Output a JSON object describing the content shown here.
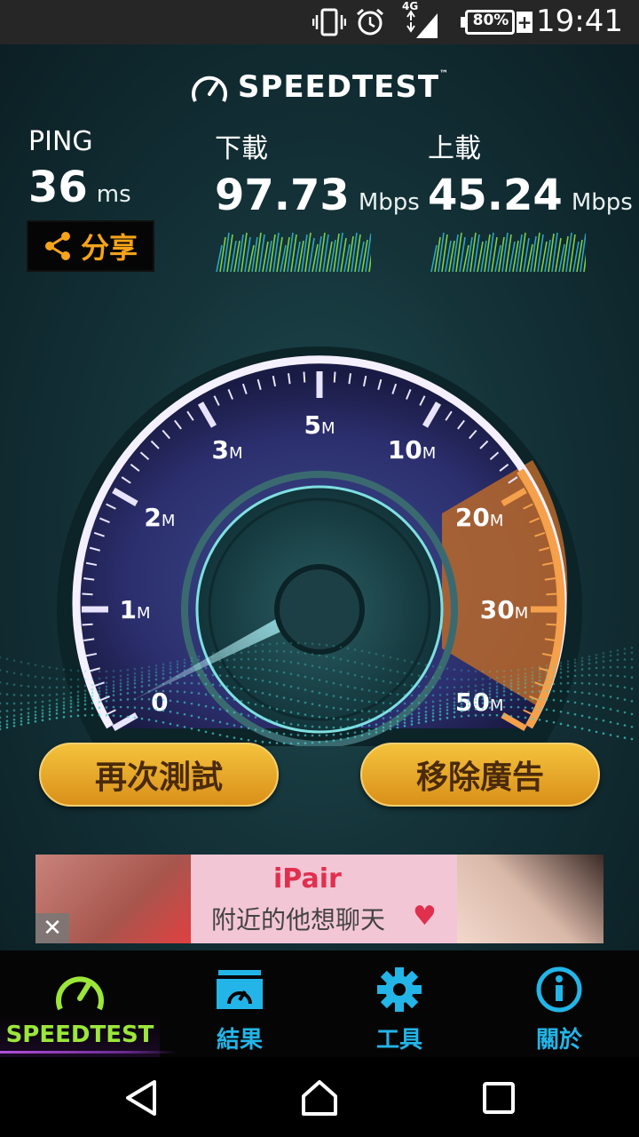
{
  "status_bar": {
    "time": "19:41",
    "battery": "80%",
    "network": "4G",
    "icons": [
      "vibrate-icon",
      "alarm-icon",
      "signal-icon",
      "battery-icon"
    ]
  },
  "app": {
    "brand": "SPEEDTEST",
    "brand_tm": "™"
  },
  "metrics": {
    "ping": {
      "label": "PING",
      "value": "36",
      "unit": "ms"
    },
    "download": {
      "label": "下載",
      "value": "97.73",
      "unit": "Mbps"
    },
    "upload": {
      "label": "上載",
      "value": "45.24",
      "unit": "Mbps"
    }
  },
  "share": {
    "label": "分享"
  },
  "gauge": {
    "scale_labels": [
      "0",
      "1",
      "2",
      "3",
      "5",
      "10",
      "20",
      "30",
      "50"
    ],
    "unit_letter": "M"
  },
  "actions": {
    "retest": "再次測試",
    "remove_ads": "移除廣告"
  },
  "ad": {
    "brand": "iPair",
    "text": "附近的他想聊天",
    "close": "✕"
  },
  "tabs": [
    {
      "label": "SPEEDTEST",
      "icon": "gauge-icon",
      "active": true
    },
    {
      "label": "結果",
      "icon": "folder-gauge-icon",
      "active": false
    },
    {
      "label": "工具",
      "icon": "gear-icon",
      "active": false
    },
    {
      "label": "關於",
      "icon": "info-icon",
      "active": false
    }
  ],
  "colors": {
    "accent_orange": "#f5a31a",
    "tab_blue": "#23b5e8",
    "tab_active_green": "#9ce63a",
    "button_gold": "#e6a828"
  }
}
